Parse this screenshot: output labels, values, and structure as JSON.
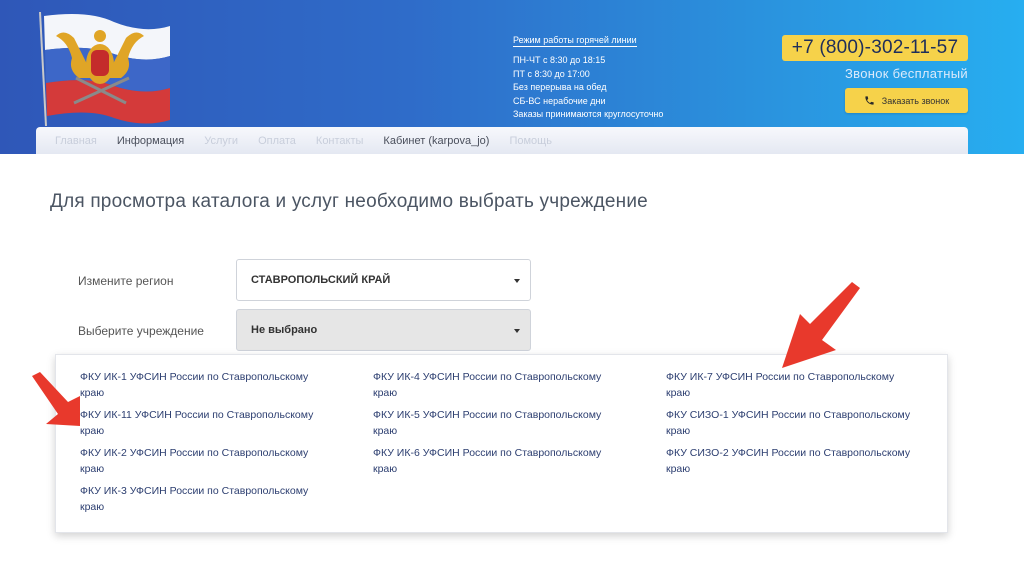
{
  "header": {
    "hours_title": "Режим работы горячей линии",
    "hours_lines": [
      "ПН-ЧТ с 8:30 до 18:15",
      "ПТ с 8:30 до 17:00",
      "Без перерыва на обед",
      "СБ-ВС нерабочие дни",
      "Заказы принимаются круглосуточно"
    ],
    "phone": "+7 (800)-302-11-57",
    "free_call": "Звонок бесплатный",
    "callback_button": "Заказать звонок"
  },
  "nav": {
    "items": [
      {
        "label": "Главная"
      },
      {
        "label": "Информация"
      },
      {
        "label": "Услуги"
      },
      {
        "label": "Оплата"
      },
      {
        "label": "Контакты"
      },
      {
        "label": "Кабинет (karpova_jo)"
      },
      {
        "label": "Помощь"
      }
    ]
  },
  "main": {
    "title": "Для просмотра каталога и услуг необходимо выбрать учреждение",
    "region_label": "Измените регион",
    "region_value": "СТАВРОПОЛЬСКИЙ КРАЙ",
    "institution_label": "Выберите учреждение",
    "institution_value": "Не выбрано"
  },
  "dropdown": {
    "options": [
      "ФКУ ИК-1 УФСИН России по Ставропольскому краю",
      "ФКУ ИК-11 УФСИН России по Ставропольскому краю",
      "ФКУ ИК-2 УФСИН России по Ставропольскому краю",
      "ФКУ ИК-3 УФСИН России по Ставропольскому краю",
      "ФКУ ИК-4 УФСИН России по Ставропольскому краю",
      "ФКУ ИК-5 УФСИН России по Ставропольскому краю",
      "ФКУ ИК-6 УФСИН России по Ставропольскому краю",
      "ФКУ ИК-7 УФСИН России по Ставропольскому краю",
      "ФКУ СИЗО-1 УФСИН России по Ставропольскому краю",
      "ФКУ СИЗО-2 УФСИН России по Ставропольскому краю"
    ]
  },
  "icons": {
    "logo": "flag-emblem-logo",
    "phone": "phone-icon",
    "caret": "chevron-down-icon",
    "annotation": "red-arrow-icon"
  },
  "colors": {
    "header_start": "#2f57b8",
    "header_end": "#27aef0",
    "accent_yellow": "#f6d24a",
    "link_blue": "#2c3e70",
    "arrow_red": "#e8392c"
  }
}
